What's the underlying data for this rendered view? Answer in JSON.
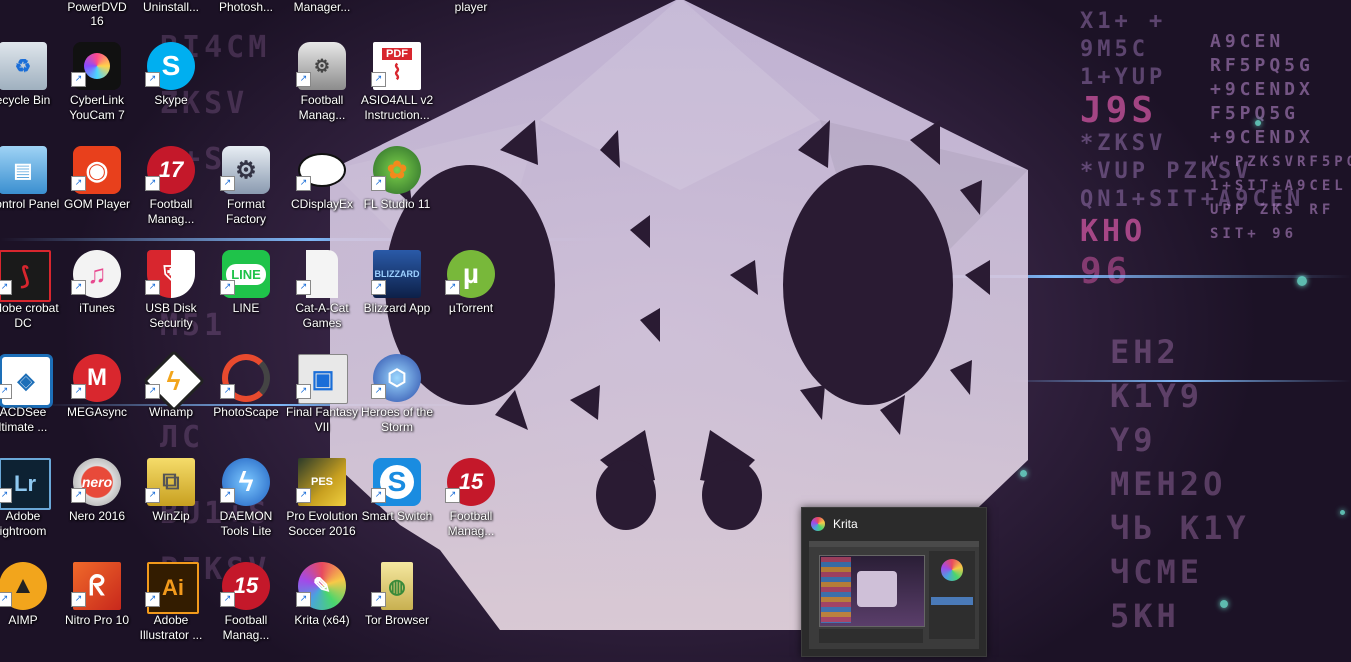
{
  "desktop": {
    "top_labels": [
      "PowerDVD 16",
      "Uninstall...",
      "Photosh...",
      "Manager...",
      "player"
    ],
    "icons": [
      {
        "label": "ecycle Bin",
        "icon": "recycle-bin-icon",
        "color": "#cfd8e0"
      },
      {
        "label": "CyberLink YouCam 7",
        "icon": "youcam-icon",
        "color": "#111111"
      },
      {
        "label": "Skype",
        "icon": "skype-icon",
        "color": "#00aff0"
      },
      {
        "label": "Football Manag...",
        "icon": "football-manager-tool-icon",
        "color": "#bbbbbb"
      },
      {
        "label": "ASIO4ALL v2 Instruction...",
        "icon": "pdf-file-icon",
        "color": "#ffffff"
      },
      {
        "label": "Control Panel",
        "icon": "control-panel-icon",
        "color": "#4aa3df"
      },
      {
        "label": "GOM Player",
        "icon": "gom-player-icon",
        "color": "#e8401c"
      },
      {
        "label": "Football Manag...",
        "icon": "football-manager-17-icon",
        "color": "#c4182a"
      },
      {
        "label": "Format Factory",
        "icon": "format-factory-icon",
        "color": "#9aa8b8"
      },
      {
        "label": "CDisplayEx",
        "icon": "speech-bubble-icon",
        "color": "#ffffff"
      },
      {
        "label": "FL Studio 11",
        "icon": "fl-studio-icon",
        "color": "#f28a1c"
      },
      {
        "label": "Adobe crobat DC",
        "icon": "acrobat-icon",
        "color": "#1a1a1a"
      },
      {
        "label": "iTunes",
        "icon": "itunes-icon",
        "color": "#f3f3f3"
      },
      {
        "label": "USB Disk Security",
        "icon": "shield-icon",
        "color": "#d8262e"
      },
      {
        "label": "LINE",
        "icon": "line-icon",
        "color": "#1fc34a"
      },
      {
        "label": "Cat-A-Cat Games",
        "icon": "blank-file-icon",
        "color": "#f4f4f4"
      },
      {
        "label": "Blizzard App",
        "icon": "blizzard-icon",
        "color": "#163a78"
      },
      {
        "label": "µTorrent",
        "icon": "utorrent-icon",
        "color": "#78b83a"
      },
      {
        "label": "ACDSee ltimate ...",
        "icon": "acdsee-icon",
        "color": "#1d6fb8"
      },
      {
        "label": "MEGAsync",
        "icon": "mega-icon",
        "color": "#d9272e"
      },
      {
        "label": "Winamp",
        "icon": "winamp-icon",
        "color": "#222222"
      },
      {
        "label": "PhotoScape",
        "icon": "photoscape-icon",
        "color": "#333333"
      },
      {
        "label": "Final Fantasy VII",
        "icon": "window-icon",
        "color": "#e8e8e8"
      },
      {
        "label": "Heroes of the Storm",
        "icon": "heroes-storm-icon",
        "color": "#3c6fc8"
      },
      {
        "label": "Adobe ightroom",
        "icon": "lightroom-icon",
        "color": "#0d2233"
      },
      {
        "label": "Nero 2016",
        "icon": "nero-icon",
        "color": "#e0e0e0"
      },
      {
        "label": "WinZip",
        "icon": "winzip-icon",
        "color": "#e8c43a"
      },
      {
        "label": "DAEMON Tools Lite",
        "icon": "lightning-icon",
        "color": "#1e7fe0"
      },
      {
        "label": "Pro Evolution Soccer 2016",
        "icon": "pes-icon",
        "color": "#c8a020"
      },
      {
        "label": "Smart Switch",
        "icon": "smart-switch-icon",
        "color": "#1a8ce0"
      },
      {
        "label": "Football Manag...",
        "icon": "football-manager-15-icon",
        "color": "#c4182a"
      },
      {
        "label": "AIMP",
        "icon": "aimp-icon",
        "color": "#f2a51c"
      },
      {
        "label": "Nitro Pro 10",
        "icon": "nitro-icon",
        "color": "#e8401c"
      },
      {
        "label": "Adobe Illustrator ...",
        "icon": "illustrator-icon",
        "color": "#331c00"
      },
      {
        "label": "Football Manag...",
        "icon": "football-manager-15-icon",
        "color": "#c4182a"
      },
      {
        "label": "Krita (x64)",
        "icon": "krita-icon",
        "color": "#e8e8f0"
      },
      {
        "label": "Tor Browser",
        "icon": "tor-browser-icon",
        "color": "#e8d070"
      }
    ]
  },
  "glyph_text": {
    "top_right": [
      "X1+ +",
      "9M5C",
      "1+YUP",
      "J9S",
      "*ZKSV",
      "*VUP PZKSV",
      "QN1+SIT+A9CEN",
      "KHO",
      "96",
      "P",
      "4"
    ],
    "right_col": [
      "A9CEN",
      "RF5PQ5G",
      "+9CENDX",
      "F5PQ5G",
      "+9CENDX",
      "V PZKSVRF5PQ",
      "1+SIT+A9CEL",
      "UPP ZKS RF",
      "SIT+ 96",
      "Ч",
      "ЧЕ",
      "EH2",
      "K1Y9",
      "Y9",
      "MEH2O",
      "ЧЬ K1Y",
      "ЧСМЕ",
      "5KH"
    ],
    "left_col": [
      "BI4CM",
      "ZKSV",
      "1+S1",
      "M51",
      "ЧЬ",
      "ЛС",
      "BU1+S",
      "PZKSV",
      "SIT+A9CE"
    ]
  },
  "taskbar_preview": {
    "title": "Krita",
    "icon": "krita-icon"
  }
}
